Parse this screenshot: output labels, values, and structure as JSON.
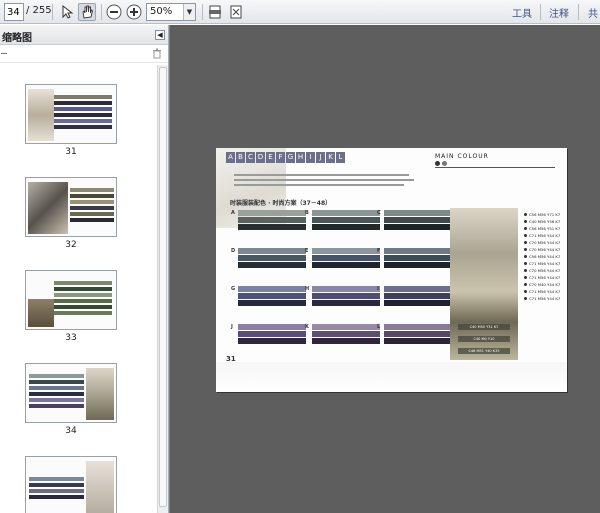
{
  "toolbar": {
    "page_current": "34",
    "page_total": "/ 255",
    "zoom": "50%",
    "tools_label": "工具",
    "comment_label": "注释",
    "share_label": "共"
  },
  "left_panel": {
    "title": "缩略图",
    "thumbnails": [
      {
        "label": "31"
      },
      {
        "label": "32"
      },
      {
        "label": "33"
      },
      {
        "label": "34"
      },
      {
        "label": ""
      }
    ]
  },
  "document_page": {
    "letters": [
      "A",
      "B",
      "C",
      "D",
      "E",
      "F",
      "G",
      "H",
      "I",
      "J",
      "K",
      "L"
    ],
    "main_colour": "MAIN COLOUR",
    "heading": "时装服装配色 · 时尚方案（37－48）",
    "page_number": "31",
    "swatch_groups": [
      {
        "letter": "A",
        "colors": [
          "#9aa09a",
          "#5a6260",
          "#2b2e2f"
        ]
      },
      {
        "letter": "B",
        "colors": [
          "#8b9594",
          "#495556",
          "#232829"
        ]
      },
      {
        "letter": "C",
        "colors": [
          "#7a8a86",
          "#3f4b4a",
          "#1f2425"
        ]
      },
      {
        "letter": "D",
        "colors": [
          "#7d8791",
          "#4a5664",
          "#262c33"
        ]
      },
      {
        "letter": "E",
        "colors": [
          "#8a96a2",
          "#46536a",
          "#20252e"
        ]
      },
      {
        "letter": "F",
        "colors": [
          "#6d7b84",
          "#3b4b57",
          "#1c2329"
        ]
      },
      {
        "letter": "G",
        "colors": [
          "#7c82a2",
          "#4b5276",
          "#262a3c"
        ]
      },
      {
        "letter": "H",
        "colors": [
          "#8a86a8",
          "#4f4c75",
          "#29283c"
        ]
      },
      {
        "letter": "I",
        "colors": [
          "#6d6f8e",
          "#3f4060",
          "#1f2031"
        ]
      },
      {
        "letter": "J",
        "colors": [
          "#8c7ea6",
          "#5a4c78",
          "#2c2640"
        ]
      },
      {
        "letter": "K",
        "colors": [
          "#9a88a9",
          "#5e4e70",
          "#2d263a"
        ]
      },
      {
        "letter": "L",
        "colors": [
          "#8a7a99",
          "#574865",
          "#2a2433"
        ]
      }
    ],
    "photo_labels": [
      "C40 M50 Y31 K7",
      "C40 M0 Y10",
      "C46 M51 Y40 K33"
    ],
    "color_list": [
      "C56 M56 Y71 K7",
      "C40 M56 Y56 K7",
      "C56 M56 Y51 K7",
      "C71 M56 Y44 K7",
      "C70 M56 Y44 K7",
      "C70 M56 Y44 K7",
      "C56 M56 Y44 K7",
      "C71 M56 Y44 K7",
      "C70 M56 Y44 K7",
      "C71 M56 Y44 K7",
      "C70 M40 Y44 K7",
      "C71 M56 Y44 K7",
      "C71 M56 Y44 K7"
    ]
  },
  "colors": {
    "viewer_bg": "#5e5e5e",
    "toolbar_accent": "#3d5687"
  }
}
